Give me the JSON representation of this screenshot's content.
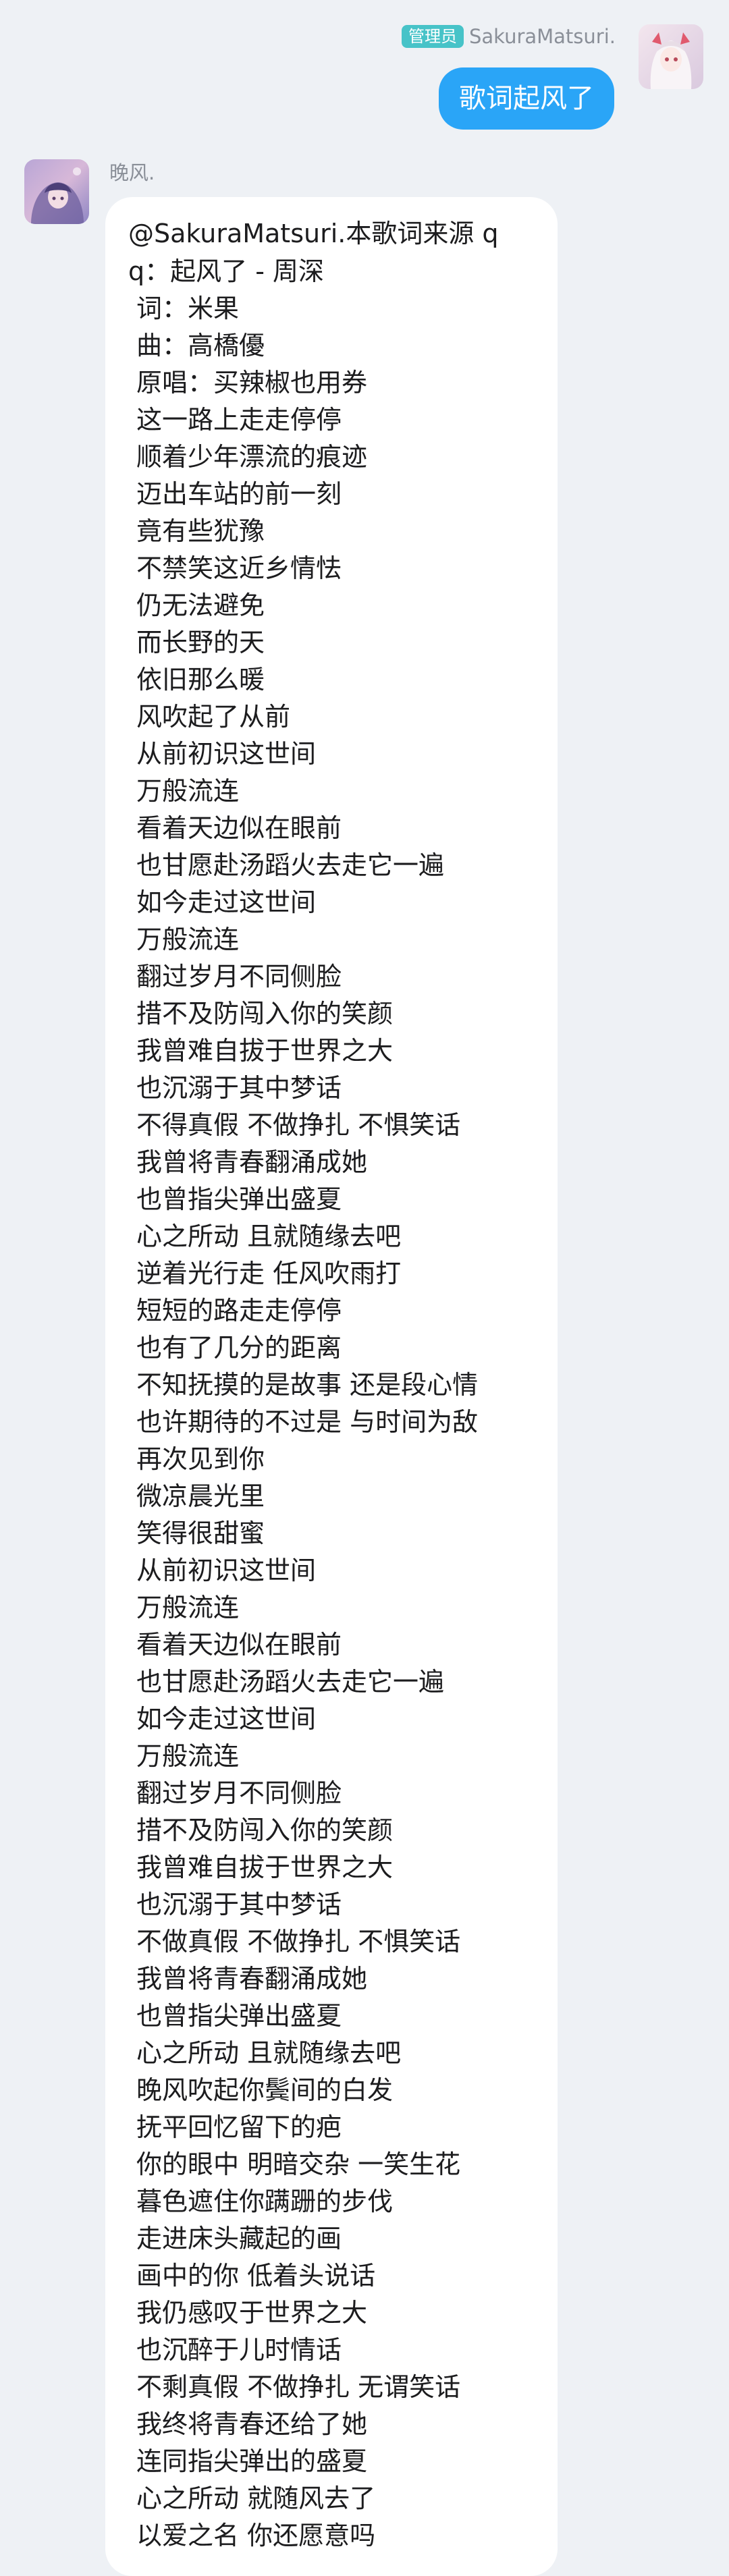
{
  "outgoing": {
    "role_badge": "管理员",
    "sender_name": "SakuraMatsuri.",
    "message": "歌词起风了"
  },
  "incoming": {
    "sender_name": "晚风.",
    "header": "@SakuraMatsuri.本歌词来源 qq：起风了 - 周深",
    "lines": [
      "词：米果",
      "曲：高橋優",
      "原唱：买辣椒也用券",
      "这一路上走走停停",
      "顺着少年漂流的痕迹",
      "迈出车站的前一刻",
      "竟有些犹豫",
      "不禁笑这近乡情怯",
      "仍无法避免",
      "而长野的天",
      "依旧那么暖",
      "风吹起了从前",
      "从前初识这世间",
      "万般流连",
      "看着天边似在眼前",
      "也甘愿赴汤蹈火去走它一遍",
      "如今走过这世间",
      "万般流连",
      "翻过岁月不同侧脸",
      "措不及防闯入你的笑颜",
      "我曾难自拔于世界之大",
      "也沉溺于其中梦话",
      "不得真假 不做挣扎 不惧笑话",
      "我曾将青春翻涌成她",
      "也曾指尖弹出盛夏",
      "心之所动 且就随缘去吧",
      "逆着光行走 任风吹雨打",
      "短短的路走走停停",
      "也有了几分的距离",
      "不知抚摸的是故事 还是段心情",
      "也许期待的不过是 与时间为敌",
      "再次见到你",
      "微凉晨光里",
      "笑得很甜蜜",
      "从前初识这世间",
      "万般流连",
      "看着天边似在眼前",
      "也甘愿赴汤蹈火去走它一遍",
      "如今走过这世间",
      "万般流连",
      "翻过岁月不同侧脸",
      "措不及防闯入你的笑颜",
      "我曾难自拔于世界之大",
      "也沉溺于其中梦话",
      "不做真假 不做挣扎 不惧笑话",
      "我曾将青春翻涌成她",
      "也曾指尖弹出盛夏",
      "心之所动 且就随缘去吧",
      "晚风吹起你鬓间的白发",
      "抚平回忆留下的疤",
      "你的眼中 明暗交杂 一笑生花",
      "暮色遮住你蹒跚的步伐",
      "走进床头藏起的画",
      "画中的你 低着头说话",
      "我仍感叹于世界之大",
      "也沉醉于儿时情话",
      "不剩真假 不做挣扎 无谓笑话",
      "我终将青春还给了她",
      "连同指尖弹出的盛夏",
      "心之所动 就随风去了",
      "以爱之名 你还愿意吗"
    ]
  },
  "colors": {
    "background": "#eef1f5",
    "outgoing_bubble": "#2aa5f7",
    "role_badge": "#47c3c8"
  },
  "icons": {
    "outgoing_avatar": "anime-girl-avatar",
    "incoming_avatar": "anime-girl-avatar"
  }
}
